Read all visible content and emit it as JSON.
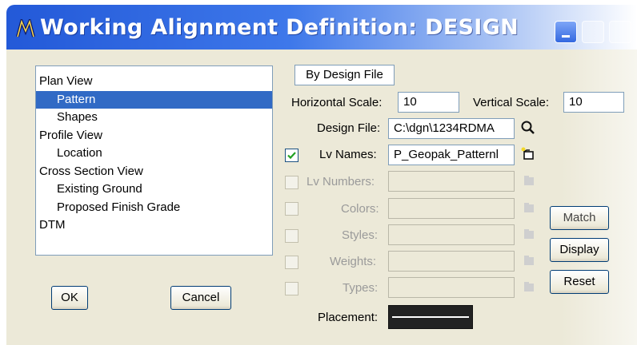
{
  "window": {
    "title": "Working Alignment Definition: DESIGN",
    "app_icon": "microstation-icon",
    "controls": [
      "minimize-icon",
      "maximize-icon",
      "close-icon"
    ]
  },
  "tree": {
    "items": [
      {
        "label": "Plan View",
        "level": 0
      },
      {
        "label": "Pattern",
        "level": 1,
        "selected": true
      },
      {
        "label": "Shapes",
        "level": 1
      },
      {
        "label": "Profile View",
        "level": 0
      },
      {
        "label": "Location",
        "level": 1
      },
      {
        "label": "Cross Section View",
        "level": 0
      },
      {
        "label": "Existing Ground",
        "level": 1
      },
      {
        "label": "Proposed Finish Grade",
        "level": 1
      },
      {
        "label": "DTM",
        "level": 0
      }
    ]
  },
  "buttons": {
    "ok": "OK",
    "cancel": "Cancel",
    "match": "Match",
    "display": "Display",
    "reset": "Reset"
  },
  "source_mode": "By Design File",
  "scale": {
    "horizontal_label": "Horizontal Scale:",
    "horizontal_value": "10",
    "vertical_label": "Vertical Scale:",
    "vertical_value": "10"
  },
  "design_file": {
    "label": "Design File:",
    "value": "C:\\dgn\\1234RDMA"
  },
  "filters": {
    "lv_names": {
      "label": "Lv Names:",
      "value": "P_Geopak_Patternl",
      "checked": true
    },
    "lv_numbers": {
      "label": "Lv Numbers:",
      "value": ""
    },
    "colors": {
      "label": "Colors:",
      "value": ""
    },
    "styles": {
      "label": "Styles:",
      "value": ""
    },
    "weights": {
      "label": "Weights:",
      "value": ""
    },
    "types": {
      "label": "Types:",
      "value": ""
    }
  },
  "placement": {
    "label": "Placement:"
  },
  "colors": {
    "titlebar": "#2359d8",
    "selection": "#316ac5",
    "dialog_bg": "#ece9d8"
  }
}
